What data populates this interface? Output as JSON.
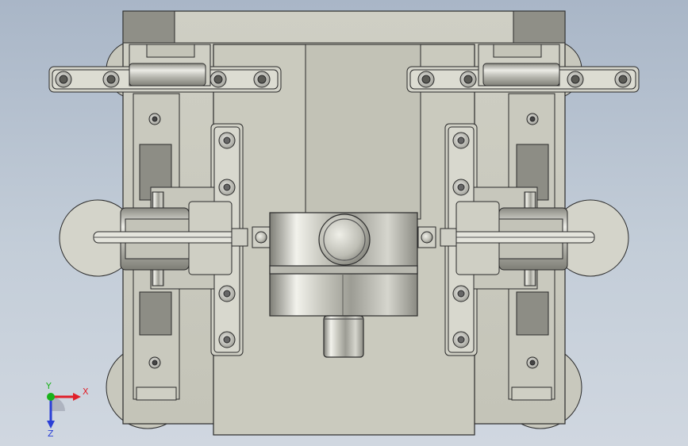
{
  "view": {
    "type": "cad-front-view",
    "background_top": "#a9b6c7",
    "background_bottom": "#d0d7e0"
  },
  "triad": {
    "x_label": "X",
    "y_label": "Y",
    "z_label": "Z",
    "x_color": "#e0202a",
    "y_color": "#18b21a",
    "z_color": "#2a3fd6"
  }
}
